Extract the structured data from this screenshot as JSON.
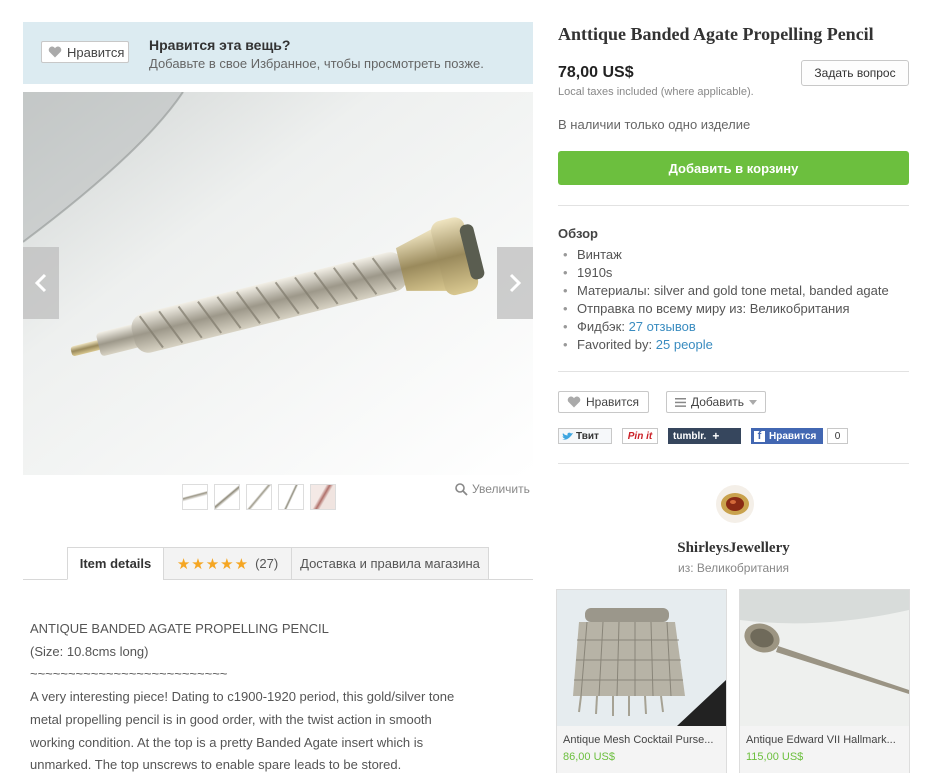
{
  "favorite_banner": {
    "button_label": "Нравится",
    "title": "Нравится эта вещь?",
    "subtitle": "Добавьте в свое Избранное, чтобы просмотреть позже."
  },
  "gallery": {
    "zoom_label": "Увеличить",
    "thumbnail_count": 5
  },
  "tabs": [
    {
      "label": "Item details"
    },
    {
      "stars": "★★★★★",
      "count": "(27)",
      "rating": 5
    },
    {
      "label": "Доставка и правила магазина"
    }
  ],
  "description": [
    "ANTIQUE BANDED AGATE PROPELLING PENCIL",
    "(Size: 10.8cms long)",
    "~~~~~~~~~~~~~~~~~~~~~~~~~~",
    "A very interesting piece! Dating to c1900-1920 period, this gold/silver tone",
    "metal propelling pencil is in good order, with the twist action in smooth",
    "working condition. At the top is a pretty Banded Agate insert which is",
    "unmarked. The top unscrews to enable spare leads to be stored."
  ],
  "product": {
    "title": "Anttique Banded Agate Propelling Pencil",
    "price": "78,00 US$",
    "tax_note": "Local taxes included (where applicable).",
    "ask_button": "Задать вопрос",
    "stock": "В наличии только одно изделие",
    "add_to_cart": "Добавить в корзину"
  },
  "overview": {
    "title": "Обзор",
    "items": {
      "type": "Винтаж",
      "year": "1910s",
      "materials": "Материалы: silver and gold tone metal, banded agate",
      "shipping": "Отправка по всему миру из: Великобритания",
      "feedback_label": "Фидбэк: ",
      "feedback_link": "27 отзывов",
      "favorited_label": "Favorited by: ",
      "favorited_link": "25 people"
    }
  },
  "actions": {
    "like": "Нравится",
    "add": "Добавить"
  },
  "social": {
    "twitter": "Твит",
    "pinterest": "Pin it",
    "tumblr": "tumblr.",
    "facebook": "Нравится",
    "facebook_count": "0"
  },
  "shop": {
    "name": "ShirleysJewellery",
    "location": "из: Великобритания"
  },
  "related": [
    {
      "title": "Antique Mesh Cocktail Purse...",
      "price": "86,00 US$"
    },
    {
      "title": "Antique Edward VII Hallmark...",
      "price": "115,00 US$"
    }
  ],
  "colors": {
    "accent_green": "#6cbf3e",
    "link_blue": "#3a8cc0",
    "banner_bg": "#dcebf1",
    "star": "#f5a623"
  }
}
